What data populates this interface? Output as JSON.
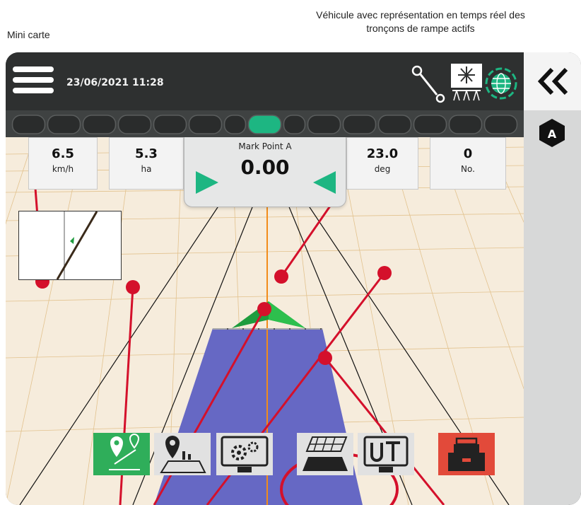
{
  "callouts": {
    "minimap": "Mini carte",
    "vehicle_line1": "Véhicule avec représentation en temps réel des",
    "vehicle_line2": "tronçons de rampe actifs"
  },
  "header": {
    "datetime": "23/06/2021 11:28"
  },
  "icons": {
    "menu": "hamburger-menu-icon",
    "guidance_point": "guidance-point-icon",
    "boom_sprayer": "boom-sprayer-icon",
    "gnss_globe": "gnss-globe-icon",
    "collapse": "double-chevron-left-icon",
    "mark_a": "mark-point-a-icon"
  },
  "sections": {
    "count": 15,
    "active_index": 7
  },
  "tiles": {
    "speed": {
      "value": "6.5",
      "unit": "km/h"
    },
    "area": {
      "value": "5.3",
      "unit": "ha"
    },
    "heading": {
      "value": "23.0",
      "unit": "deg"
    },
    "count": {
      "value": "0",
      "unit": "No."
    }
  },
  "guidance": {
    "label": "Mark Point A",
    "value": "0.00"
  },
  "bottom_buttons": [
    {
      "name": "guidance-mode-button",
      "icon": "guidance-mode-icon"
    },
    {
      "name": "job-mapping-button",
      "icon": "job-mapping-icon"
    },
    {
      "name": "machine-settings-button",
      "icon": "settings-gears-icon"
    },
    {
      "name": "coverage-map-button",
      "icon": "coverage-map-icon"
    },
    {
      "name": "universal-terminal-button",
      "icon": "ut-icon"
    },
    {
      "name": "product-control-button",
      "icon": "product-toolbox-icon"
    }
  ],
  "colors": {
    "green_accent": "#1db682",
    "red_callout": "#d4102b",
    "coverage": "#6668c4",
    "product_button": "#e24a3a"
  }
}
